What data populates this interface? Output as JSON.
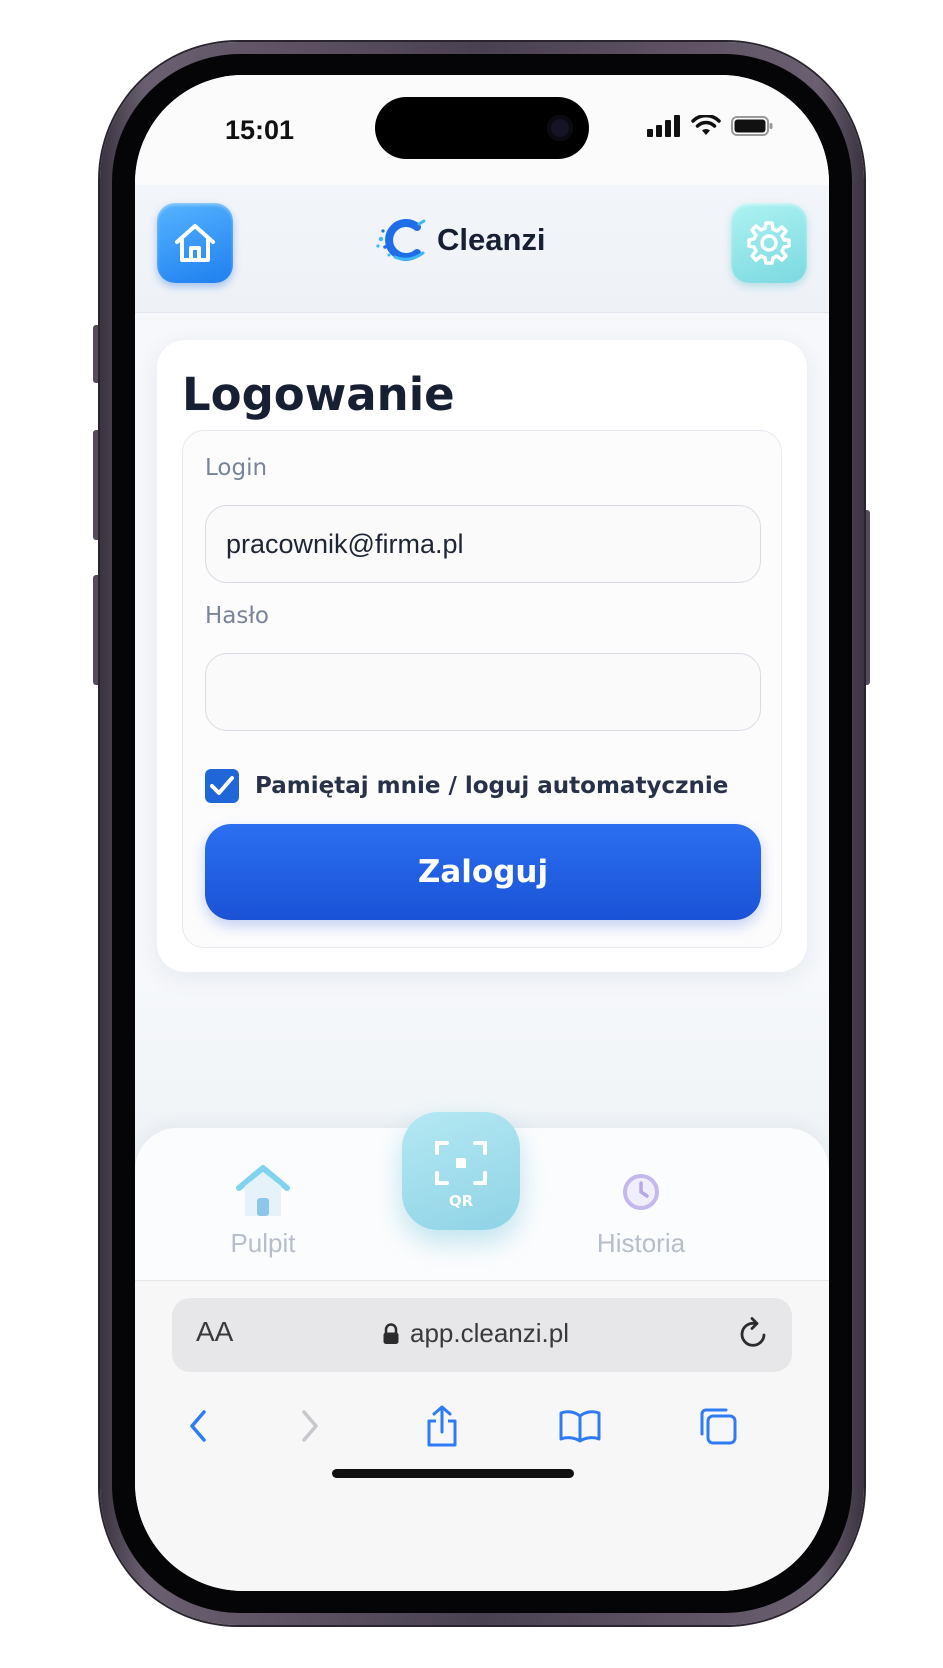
{
  "status_bar": {
    "time": "15:01"
  },
  "app_header": {
    "brand_name": "Cleanzi"
  },
  "login_card": {
    "title": "Logowanie",
    "login_label": "Login",
    "login_value": "pracownik@firma.pl",
    "password_label": "Hasło",
    "password_value": "",
    "remember_label": "Pamiętaj mnie / loguj automatycznie",
    "remember_checked": true,
    "submit_label": "Zaloguj"
  },
  "bottom_nav": {
    "items": [
      {
        "label": "Pulpit",
        "icon": "house-icon"
      },
      {
        "label": "QR",
        "icon": "qr-scan-icon"
      },
      {
        "label": "Historia",
        "icon": "clock-icon"
      }
    ]
  },
  "browser": {
    "text_size_label": "AA",
    "url": "app.cleanzi.pl"
  },
  "colors": {
    "primary": "#1f66d9",
    "home_button": "#2a8cf5",
    "settings_button": "#8fdfe4",
    "qr_button": "#a6def0",
    "title_text": "#172033"
  }
}
